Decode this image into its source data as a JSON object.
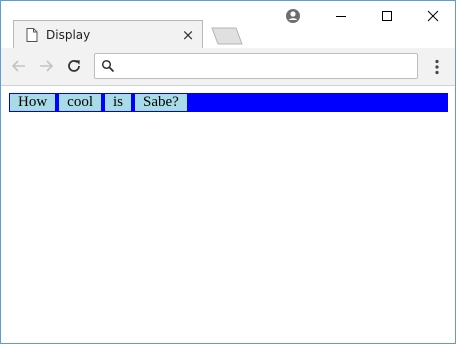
{
  "browser": {
    "tab": {
      "title": "Display",
      "close_glyph": "×"
    },
    "address_bar": {
      "value": "",
      "placeholder": ""
    }
  },
  "page": {
    "nav_links": [
      "How",
      "cool",
      "is",
      "Sabe?"
    ],
    "colors": {
      "strip": "#0000ff",
      "link_bg": "#a8dbe8"
    }
  }
}
